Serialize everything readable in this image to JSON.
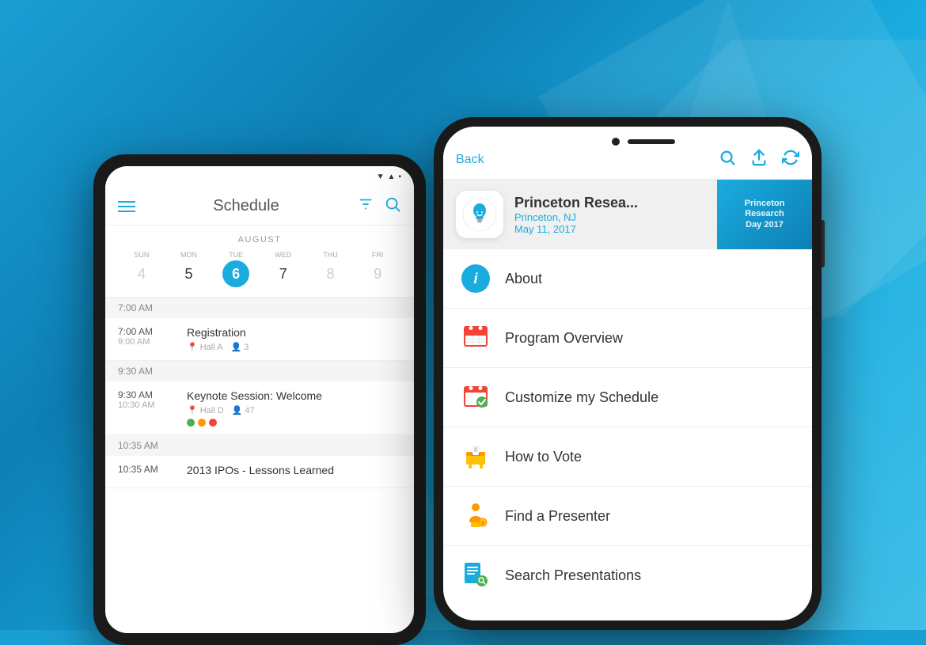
{
  "background": {
    "color": "#1a9fd4"
  },
  "android": {
    "title": "Schedule",
    "month": "AUGUST",
    "days": [
      {
        "name": "SUN",
        "num": "4",
        "style": "dim"
      },
      {
        "name": "MON",
        "num": "5",
        "style": "bold"
      },
      {
        "name": "TUE",
        "num": "6",
        "style": "active"
      },
      {
        "name": "WED",
        "num": "7",
        "style": "normal"
      },
      {
        "name": "THU",
        "num": "8",
        "style": "dim"
      },
      {
        "name": "FRI",
        "num": "9",
        "style": "dim"
      }
    ],
    "schedule": [
      {
        "timeHeader": "7:00 AM",
        "items": [
          {
            "startTime": "7:00 AM",
            "endTime": "9:00 AM",
            "title": "Registration",
            "location": "Hall A",
            "attendees": "3",
            "dots": []
          }
        ]
      },
      {
        "timeHeader": "9:30 AM",
        "items": [
          {
            "startTime": "9:30 AM",
            "endTime": "10:30 AM",
            "title": "Keynote Session: Welcome",
            "location": "Hall D",
            "attendees": "47",
            "dots": [
              "#4CAF50",
              "#FF9800",
              "#F44336"
            ]
          }
        ]
      },
      {
        "timeHeader": "10:35 AM",
        "items": [
          {
            "startTime": "10:35 AM",
            "endTime": "",
            "title": "2013 IPOs - Lessons Learned",
            "location": "",
            "attendees": "",
            "dots": []
          }
        ]
      }
    ]
  },
  "iphone": {
    "header": {
      "back_label": "Back"
    },
    "app": {
      "name": "Princeton Resea...",
      "location": "Princeton, NJ",
      "date": "May 11, 2017",
      "banner_text": "Princeton\nResearch\nDay 2017"
    },
    "menu_items": [
      {
        "id": "about",
        "label": "About",
        "icon_type": "info"
      },
      {
        "id": "program",
        "label": "Program Overview",
        "icon_type": "calendar"
      },
      {
        "id": "customize",
        "label": "Customize my Schedule",
        "icon_type": "calendar-check"
      },
      {
        "id": "vote",
        "label": "How to Vote",
        "icon_type": "vote"
      },
      {
        "id": "presenter",
        "label": "Find a Presenter",
        "icon_type": "presenter"
      },
      {
        "id": "search",
        "label": "Search Presentations",
        "icon_type": "search-pres"
      }
    ]
  }
}
